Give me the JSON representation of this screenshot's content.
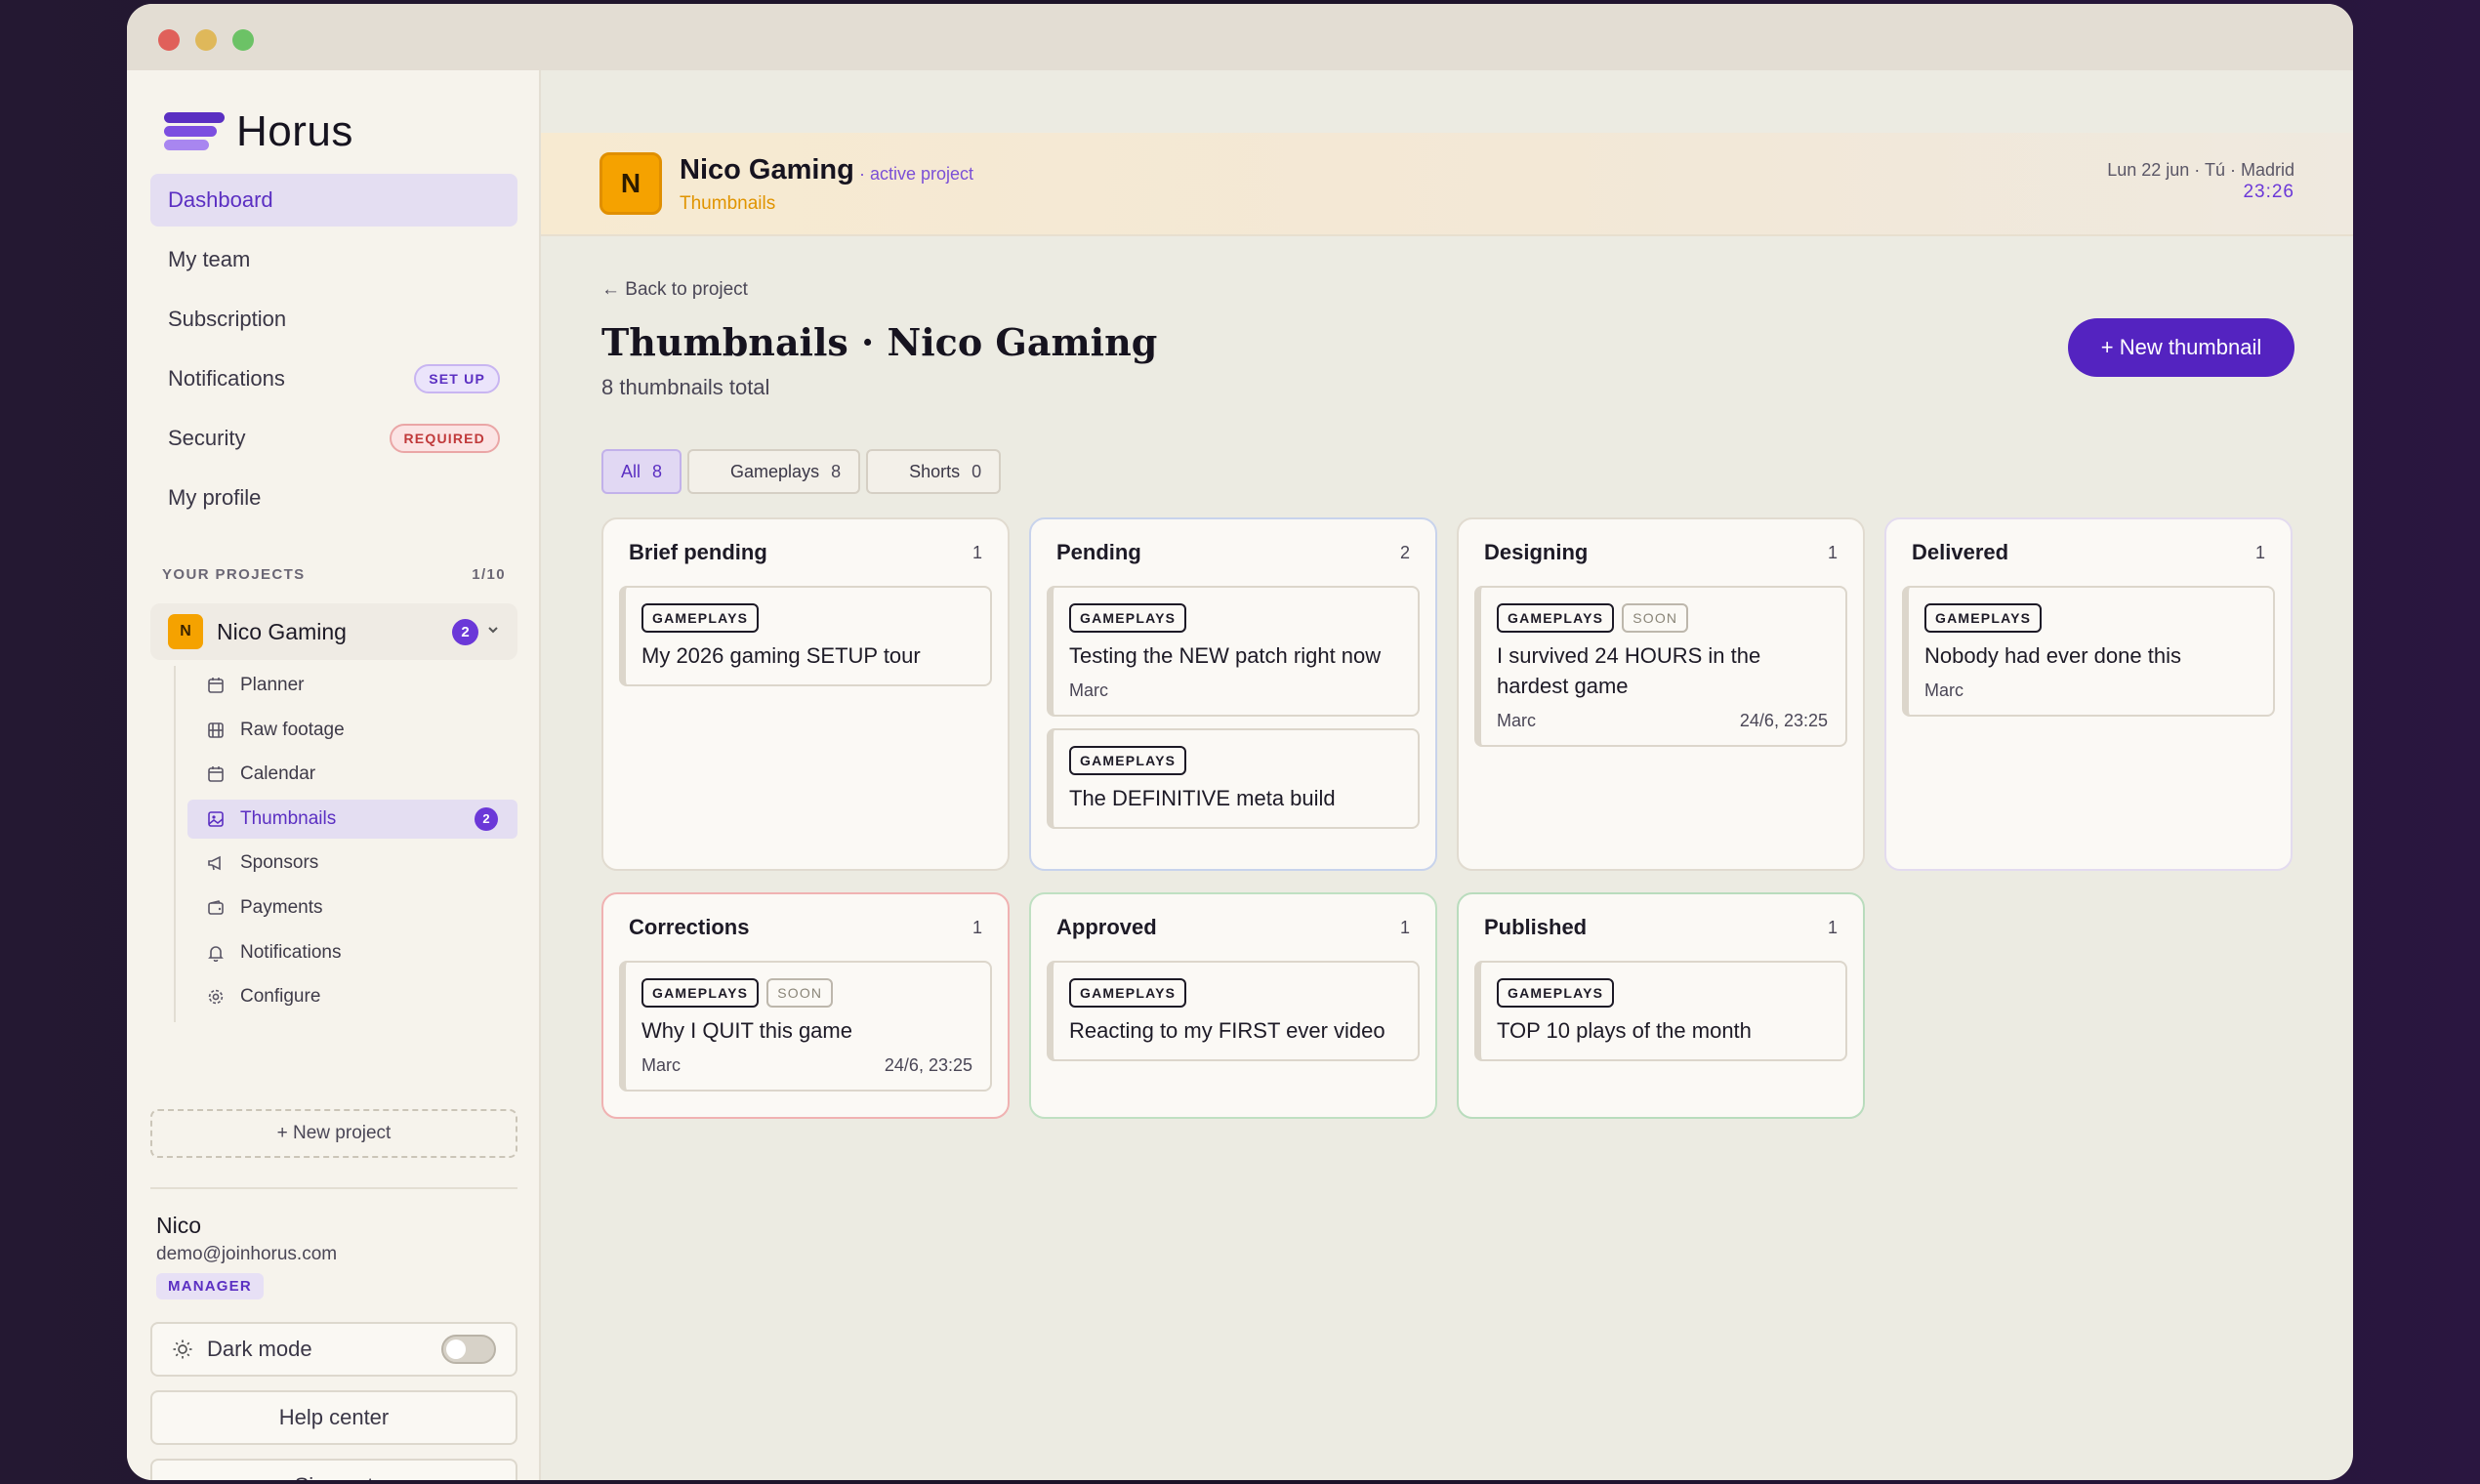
{
  "app": {
    "name": "Horus"
  },
  "sidebar": {
    "nav": [
      {
        "label": "Dashboard",
        "active": true
      },
      {
        "label": "My team"
      },
      {
        "label": "Subscription"
      },
      {
        "label": "Notifications",
        "badge": "SET UP"
      },
      {
        "label": "Security",
        "badge": "REQUIRED"
      },
      {
        "label": "My profile"
      }
    ],
    "projects_heading": "YOUR PROJECTS",
    "projects_count": "1/10",
    "project": {
      "initial": "N",
      "name": "Nico Gaming",
      "count": "2"
    },
    "subnav": [
      {
        "label": "Planner",
        "icon": "calendar-icon"
      },
      {
        "label": "Raw footage",
        "icon": "film-icon"
      },
      {
        "label": "Calendar",
        "icon": "calendar-icon"
      },
      {
        "label": "Thumbnails",
        "icon": "image-icon",
        "count": "2",
        "active": true
      },
      {
        "label": "Sponsors",
        "icon": "megaphone-icon"
      },
      {
        "label": "Payments",
        "icon": "wallet-icon"
      },
      {
        "label": "Notifications",
        "icon": "bell-icon"
      },
      {
        "label": "Configure",
        "icon": "gear-icon"
      }
    ],
    "new_project": "+ New project",
    "user": {
      "name": "Nico",
      "email": "demo@joinhorus.com",
      "role": "MANAGER"
    },
    "dark_mode": "Dark mode",
    "help": "Help center",
    "signout": "Sign out"
  },
  "banner": {
    "initial": "N",
    "title": "Nico Gaming",
    "status": "· active project",
    "subtitle": "Thumbnails",
    "date": "Lun 22 jun · Tú · Madrid",
    "time": "23:26"
  },
  "page": {
    "back": "← Back to project",
    "title": "Thumbnails · Nico Gaming",
    "subtitle": "8 thumbnails total",
    "new_button": "+ New thumbnail",
    "tabs": [
      {
        "label": "All",
        "count": "8",
        "active": true
      },
      {
        "label": "Gameplays",
        "count": "8"
      },
      {
        "label": "Shorts",
        "count": "0"
      }
    ]
  },
  "board": {
    "columns": [
      {
        "title": "Brief pending",
        "count": "1",
        "cards": [
          {
            "tag": "GAMEPLAYS",
            "title": "My 2026 gaming SETUP tour"
          }
        ]
      },
      {
        "title": "Pending",
        "count": "2",
        "cards": [
          {
            "tag": "GAMEPLAYS",
            "title": "Testing the NEW patch right now",
            "owner": "Marc"
          },
          {
            "tag": "GAMEPLAYS",
            "title": "The DEFINITIVE meta build"
          }
        ]
      },
      {
        "title": "Designing",
        "count": "1",
        "cards": [
          {
            "tag": "GAMEPLAYS",
            "soon": "SOON",
            "title": "I survived 24 HOURS in the hardest game",
            "owner": "Marc",
            "due": "24/6, 23:25"
          }
        ]
      },
      {
        "title": "Delivered",
        "count": "1",
        "cards": [
          {
            "tag": "GAMEPLAYS",
            "title": "Nobody had ever done this",
            "owner": "Marc"
          }
        ]
      },
      {
        "title": "Corrections",
        "count": "1",
        "cards": [
          {
            "tag": "GAMEPLAYS",
            "soon": "SOON",
            "title": "Why I QUIT this game",
            "owner": "Marc",
            "due": "24/6, 23:25"
          }
        ]
      },
      {
        "title": "Approved",
        "count": "1",
        "cards": [
          {
            "tag": "GAMEPLAYS",
            "title": "Reacting to my FIRST ever video"
          }
        ]
      },
      {
        "title": "Published",
        "count": "1",
        "cards": [
          {
            "tag": "GAMEPLAYS",
            "title": "TOP 10 plays of the month"
          }
        ]
      }
    ]
  }
}
